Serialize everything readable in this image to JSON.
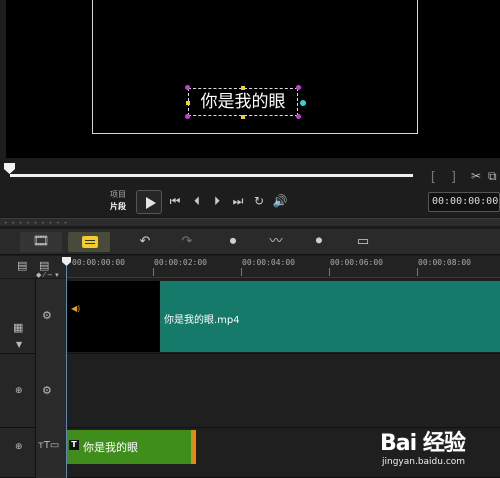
{
  "preview": {
    "title_text": "你是我的眼"
  },
  "playback": {
    "mode_project": "项目",
    "mode_clip": "片段",
    "timecode": "00:00:00:00"
  },
  "timeline": {
    "ruler_ticks": [
      "00:00:00:00",
      "00:00:02:00",
      "00:00:04:00",
      "00:00:06:00",
      "00:00:08:00"
    ],
    "video_clip_label": "你是我的眼.mp4",
    "title_clip_label": "你是我的眼"
  },
  "colors": {
    "video_clip": "#167a6a",
    "title_clip": "#3f8d1a",
    "clip_edge": "#e08a1a",
    "accent_yellow": "#f2cc2d"
  },
  "icons": {
    "play": "play-icon",
    "home": "go-to-start-icon",
    "prev_frame": "previous-frame-icon",
    "next_frame": "next-frame-icon",
    "end": "go-to-end-icon",
    "repeat": "repeat-icon",
    "volume": "volume-icon"
  },
  "watermark": {
    "logo": "Bai 经验",
    "url": "jingyan.baidu.com"
  }
}
